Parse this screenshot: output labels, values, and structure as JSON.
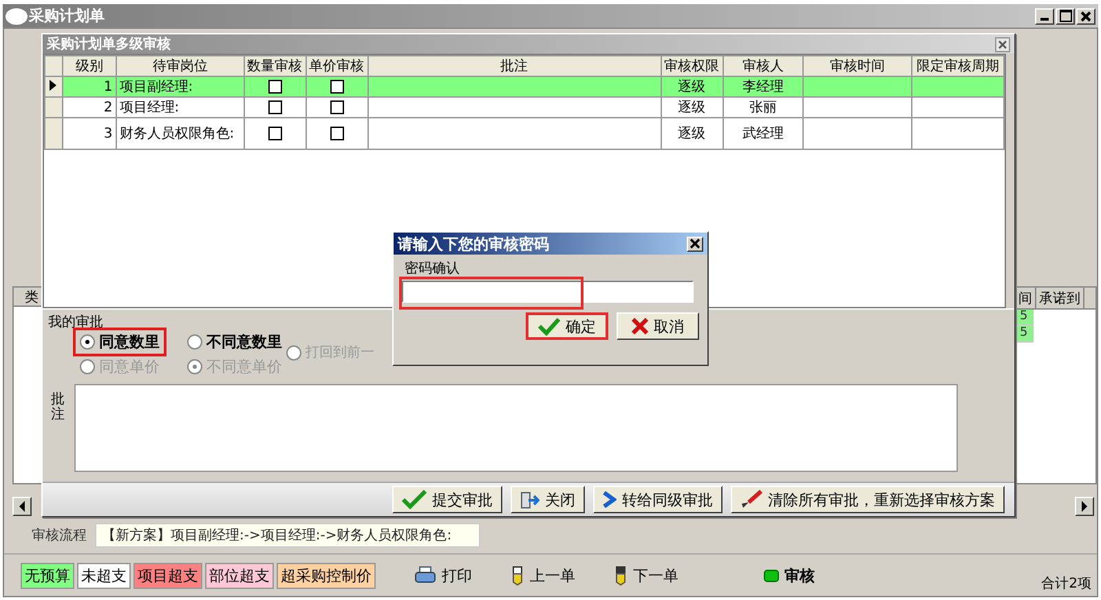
{
  "window": {
    "title": "采购计划单"
  },
  "behind": {
    "left_header": "类",
    "right_headers": [
      "间",
      "承诺到"
    ],
    "right_rows": [
      {
        "cell": "5",
        "selected": true
      },
      {
        "cell": "5",
        "selected": true
      }
    ]
  },
  "audit_dialog": {
    "title": "采购计划单多级审核",
    "columns": [
      "级别",
      "待审岗位",
      "数量审核",
      "单价审核",
      "批注",
      "审核权限",
      "审核人",
      "审核时间",
      "限定审核周期"
    ],
    "rows": [
      {
        "level": "1",
        "post": "项目副经理:",
        "qty_check": false,
        "price_check": false,
        "permission": "逐级",
        "auditor": "李经理",
        "selected": true
      },
      {
        "level": "2",
        "post": "项目经理:",
        "qty_check": false,
        "price_check": false,
        "permission": "逐级",
        "auditor": "张丽",
        "selected": false
      },
      {
        "level": "3",
        "post": "财务人员权限角色:",
        "qty_check": false,
        "price_check": false,
        "permission": "逐级",
        "auditor": "武经理",
        "selected": false
      }
    ],
    "my_approval": {
      "legend": "我的审批",
      "options": [
        {
          "label": "同意数里",
          "selected": true,
          "disabled": false,
          "highlighted": true
        },
        {
          "label": "不同意数里",
          "selected": false,
          "disabled": false,
          "highlighted": false
        },
        {
          "label": "打回到前一",
          "selected": false,
          "disabled": true,
          "highlighted": false
        },
        {
          "label": "同意单价",
          "selected": false,
          "disabled": true,
          "highlighted": false
        },
        {
          "label": "不同意单价",
          "selected": true,
          "disabled": true,
          "highlighted": false
        }
      ]
    },
    "note_label": "批注",
    "buttons": [
      {
        "label": "提交审批",
        "kind": "check"
      },
      {
        "label": "关闭",
        "kind": "exit"
      },
      {
        "label": "转给同级审批",
        "kind": "forward"
      },
      {
        "label": "清除所有审批，重新选择审核方案",
        "kind": "brush"
      }
    ]
  },
  "password_dialog": {
    "title": "请输入下您的审核密码",
    "field_label": "密码确认",
    "field_highlighted": true,
    "buttons": [
      {
        "label": "确定",
        "kind": "ok",
        "highlighted": true
      },
      {
        "label": "取消",
        "kind": "cancel",
        "highlighted": false
      }
    ]
  },
  "process": {
    "label": "审核流程",
    "value": "【新方案】项目副经理:->项目经理:->财务人员权限角色:"
  },
  "legend": [
    {
      "label": "无预算",
      "color": "#80ff80"
    },
    {
      "label": "未超支",
      "color": "#ffffff"
    },
    {
      "label": "项目超支",
      "color": "#ff8080"
    },
    {
      "label": "部位超支",
      "color": "#ffc8d8"
    },
    {
      "label": "超采购控制价",
      "color": "#ffd0a0"
    }
  ],
  "toolbar": [
    {
      "label": "打印",
      "kind": "print"
    },
    {
      "label": "上一单",
      "kind": "prev"
    },
    {
      "label": "下一单",
      "kind": "next"
    },
    {
      "label": "审核",
      "kind": "audit"
    }
  ],
  "total": "合计2项"
}
